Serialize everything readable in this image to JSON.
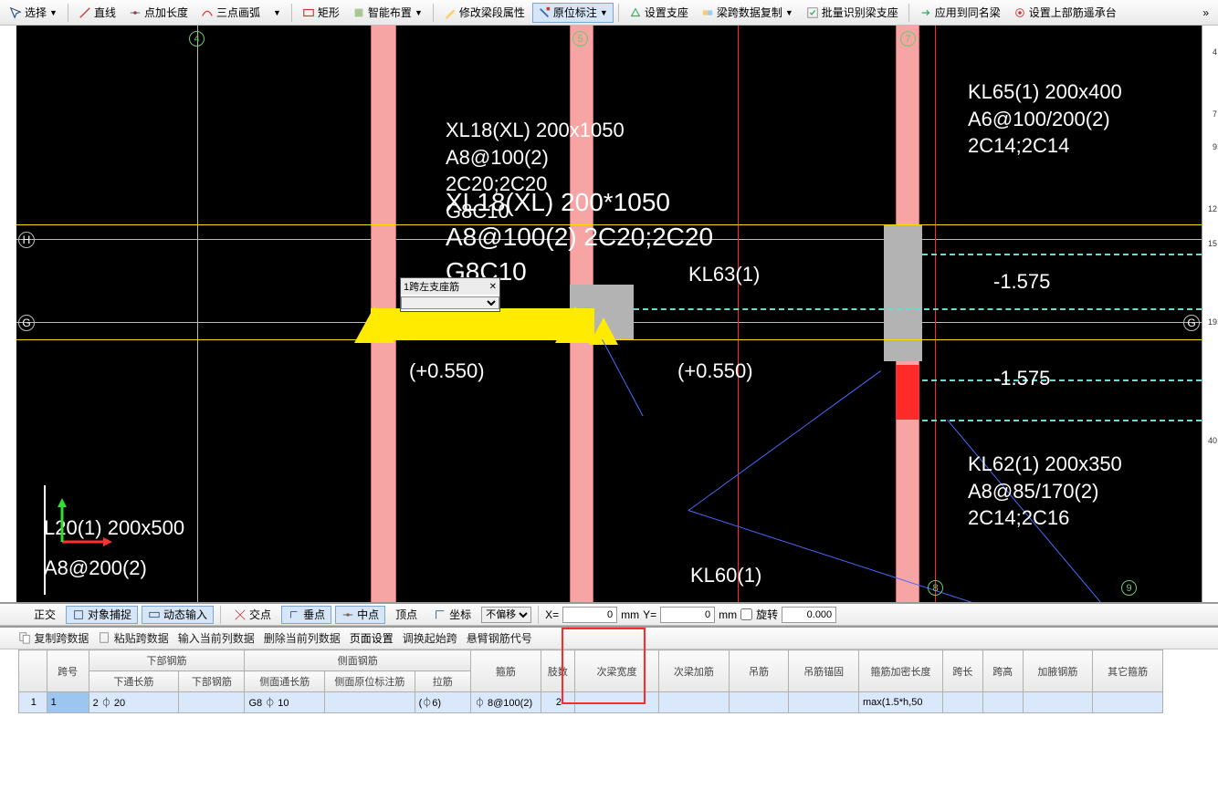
{
  "toolbar": {
    "select": "选择",
    "line": "直线",
    "point_len": "点加长度",
    "arc_3pt": "三点画弧",
    "rect": "矩形",
    "smart_place": "智能布置",
    "edit_beam_seg": "修改梁段属性",
    "in_place_annot": "原位标注",
    "set_support": "设置支座",
    "copy_beam_data": "梁跨数据复制",
    "batch_recognize": "批量识别梁支座",
    "apply_same_beam": "应用到同名梁",
    "set_upper_rebar": "设置上部筋遥承台"
  },
  "canvas": {
    "grid_numbers": [
      "4",
      "5",
      "7",
      "8",
      "9"
    ],
    "axis_letters": [
      "H",
      "G",
      "G"
    ],
    "input_label": "1跨左支座筋",
    "beam_XL18_1": [
      "XL18(XL) 200x1050",
      "A8@100(2)",
      "2C20;2C20",
      "G8C10"
    ],
    "beam_XL18_big": [
      "XL18(XL) 200*1050",
      "A8@100(2) 2C20;2C20",
      "G8C10"
    ],
    "KL63": "KL63(1)",
    "KL60": "KL60(1)",
    "plus055a": "(+0.550)",
    "plus055b": "(+0.550)",
    "L20": [
      "L20(1) 200x500",
      "A8@200(2)"
    ],
    "KL65": [
      "KL65(1) 200x400",
      "A6@100/200(2)",
      "2C14;2C14"
    ],
    "KL62": [
      "KL62(1) 200x350",
      "A8@85/170(2)",
      "2C14;2C16"
    ],
    "minus1575a": "-1.575",
    "minus1575b": "-1.575",
    "ruler": [
      "4",
      "7",
      "9",
      "12",
      "15",
      "19",
      "40"
    ]
  },
  "status": {
    "ortho": "正交",
    "osnap": "对象捕捉",
    "dynamic_input": "动态输入",
    "intersection": "交点",
    "perp": "垂点",
    "midpoint": "中点",
    "vertex": "顶点",
    "quad": "坐标",
    "offset_select": "不偏移",
    "x_label": "X=",
    "x_val": "0",
    "mm1": "mm",
    "y_label": "Y=",
    "y_val": "0",
    "mm2": "mm",
    "rotate": "旋转",
    "rotate_val": "0.000"
  },
  "actions": {
    "copy_span": "复制跨数据",
    "paste_span": "粘贴跨数据",
    "input_col": "输入当前列数据",
    "delete_col": "删除当前列数据",
    "page_setup": "页面设置",
    "swap_start": "调换起始跨",
    "cantilever": "悬臂钢筋代号"
  },
  "table": {
    "headers": {
      "span_no": "跨号",
      "lower_group": "下部钢筋",
      "lower_through": "下通长筋",
      "lower_rebar": "下部钢筋",
      "side_group": "侧面钢筋",
      "side_through": "侧面通长筋",
      "side_annot": "侧面原位标注筋",
      "tie": "拉筋",
      "stirrup": "箍筋",
      "limbs": "肢数",
      "sub_beam_width": "次梁宽度",
      "sub_beam_extra": "次梁加筋",
      "hanger": "吊筋",
      "hanger_anchor": "吊筋锚固",
      "stirrup_dense": "箍筋加密长度",
      "span_len": "跨长",
      "span_h": "跨高",
      "waist_add": "加腋钢筋",
      "other_stirrup": "其它箍筋"
    },
    "row1": {
      "num": "1",
      "span": "1",
      "lower_through": "2 ⏀ 20",
      "side_through": "G8 ⏀ 10",
      "tie": "(⏀6)",
      "stirrup": "⏀ 8@100(2)",
      "limbs": "2",
      "dense": "max(1.5*h,50"
    }
  }
}
